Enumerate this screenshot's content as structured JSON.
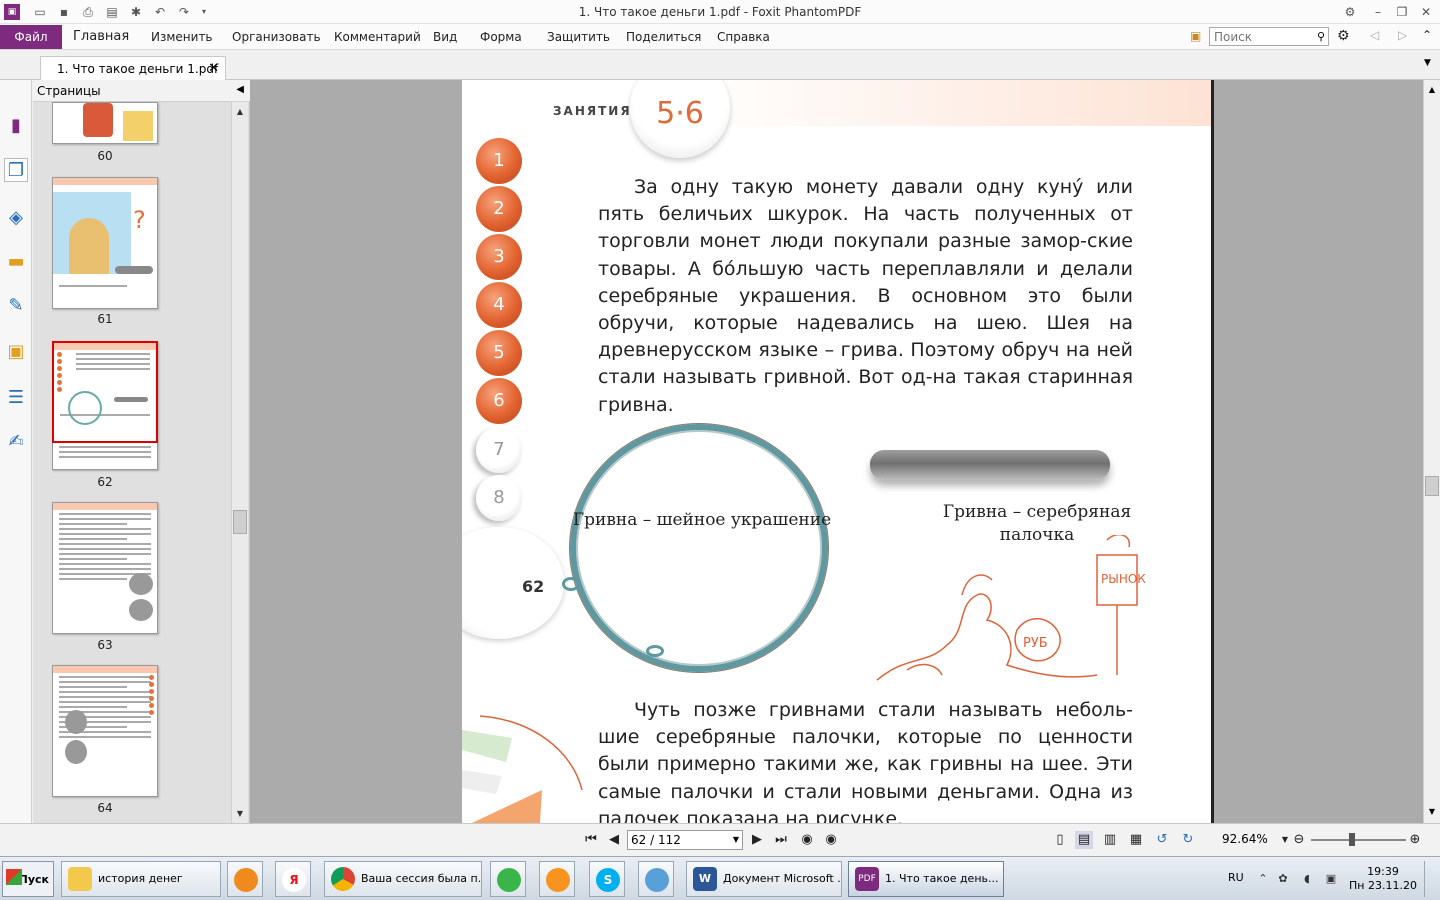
{
  "window": {
    "title": "1. Что такое деньги 1.pdf - Foxit PhantomPDF"
  },
  "menu": {
    "file": "Файл",
    "items": [
      "Главная",
      "Изменить",
      "Организовать",
      "Комментарий",
      "Вид",
      "Форма",
      "Защитить",
      "Поделиться",
      "Справка"
    ],
    "search_placeholder": "Поиск"
  },
  "tab": {
    "label": "1. Что такое деньги 1.pdf"
  },
  "pages_panel": {
    "title": "Страницы",
    "thumb_numbers": [
      "60",
      "61",
      "62",
      "63",
      "64"
    ],
    "selected": "62"
  },
  "document": {
    "section_label": "ЗАНЯТИЯ",
    "lesson_number": "5·6",
    "steps": [
      "1",
      "2",
      "3",
      "4",
      "5",
      "6",
      "7",
      "8"
    ],
    "active_steps": 6,
    "paragraph1": "За одну такую монету давали одну куну́ или пять беличьих шкурок. На часть полученных от торговли монет люди покупали разные замор-ские товары. А бо́льшую часть переплавляли и делали серебряные украшения. В основном это были обручи, которые надевались на шею. Шея на древнерусском языке – грива. Поэтому обруч на ней стали называть гривной. Вот од-на такая старинная гривна.",
    "caption_ring": "Гривна – шейное украшение",
    "caption_bar": "Гривна – серебряная палочка",
    "doodle_word1": "РЫНОК",
    "doodle_word2": "РУБ",
    "page_number": "62",
    "paragraph2": "Чуть позже гривнами стали называть неболь-шие серебряные палочки, которые по ценности были примерно такими же, как гривны на шее. Эти самые палочки и стали новыми деньгами. Одна из палочек показана на рисунке."
  },
  "navigation": {
    "page_field": "62 / 112",
    "zoom": "92.64%"
  },
  "taskbar": {
    "start": "Пуск",
    "apps": [
      {
        "label": "история денег"
      },
      {
        "label": "Ваша сессия была п..."
      },
      {
        "label": "Документ Microsoft ..."
      },
      {
        "label": "1. Что такое день..."
      }
    ],
    "lang": "RU",
    "time": "19:39",
    "date": "Пн 23.11.20"
  }
}
